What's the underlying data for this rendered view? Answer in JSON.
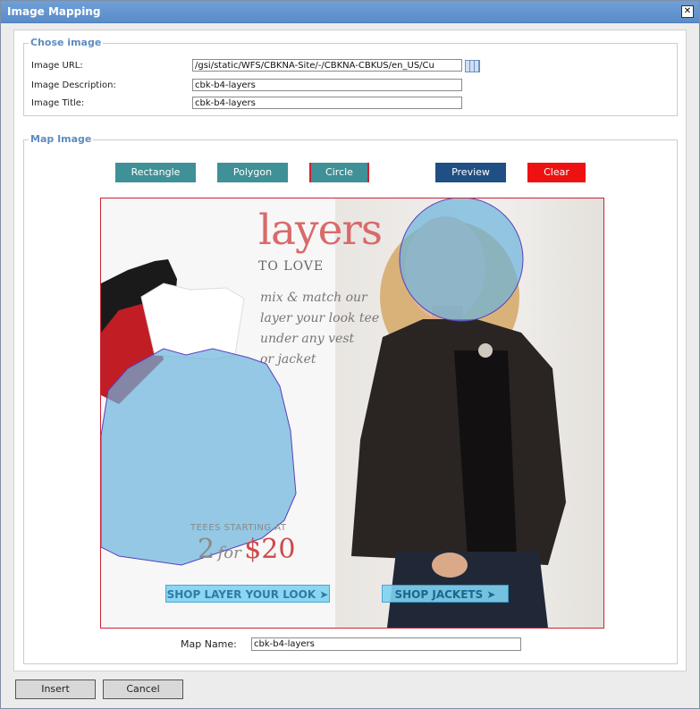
{
  "window": {
    "title": "Image Mapping"
  },
  "chose_image": {
    "legend": "Chose image",
    "url_label": "Image URL:",
    "url_value": "/gsi/static/WFS/CBKNA-Site/-/CBKNA-CBKUS/en_US/Cu",
    "desc_label": "Image Description:",
    "desc_value": "cbk-b4-layers",
    "title_label": "Image Title:",
    "title_value": "cbk-b4-layers"
  },
  "map_image": {
    "legend": "Map Image",
    "tools": {
      "rectangle": "Rectangle",
      "polygon": "Polygon",
      "circle": "Circle",
      "preview": "Preview",
      "clear": "Clear"
    },
    "image_text": {
      "headline": "layers",
      "subhead": "TO LOVE",
      "tagline_1": "mix & match our",
      "tagline_2": "layer your look tee",
      "tagline_3": "under any vest",
      "tagline_4": "or jacket",
      "tees_starting": "TEEES STARTING AT",
      "price_two": "2",
      "price_for": "for",
      "price_amount": "$20",
      "shop_layer": "SHOP LAYER YOUR LOOK ➤",
      "shop_jackets": "SHOP JACKETS ➤"
    },
    "map_name_label": "Map Name:",
    "map_name_value": "cbk-b4-layers"
  },
  "footer": {
    "insert": "Insert",
    "cancel": "Cancel"
  },
  "colors": {
    "accent_teal": "#3f9097",
    "preview_navy": "#1f4f85",
    "clear_red": "#ee1111",
    "overlay_blue": "#6ab4dc"
  }
}
